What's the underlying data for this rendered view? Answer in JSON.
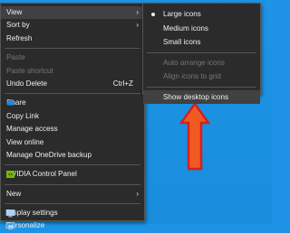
{
  "main_menu": {
    "view": "View",
    "sort_by": "Sort by",
    "refresh": "Refresh",
    "paste": "Paste",
    "paste_shortcut": "Paste shortcut",
    "undo_delete": "Undo Delete",
    "undo_delete_shortcut": "Ctrl+Z",
    "share": "Share",
    "copy_link": "Copy Link",
    "manage_access": "Manage access",
    "view_online": "View online",
    "manage_onedrive_backup": "Manage OneDrive backup",
    "nvidia_control_panel": "NVIDIA Control Panel",
    "new": "New",
    "display_settings": "Display settings",
    "personalize": "Personalize"
  },
  "view_submenu": {
    "large_icons": "Large icons",
    "medium_icons": "Medium icons",
    "small_icons": "Small icons",
    "auto_arrange_icons": "Auto arrange icons",
    "align_icons_to_grid": "Align icons to grid",
    "show_desktop_icons": "Show desktop icons"
  },
  "icons": {
    "share": "cloud-icon",
    "nvidia": "nvidia-icon",
    "display": "display-icon",
    "personalize": "personalize-icon",
    "chevron": "chevron-right-icon",
    "selected": "radio-dot-icon",
    "arrow": "up-arrow-icon"
  },
  "colors": {
    "desktop": "#1992e4",
    "menu_bg": "#2b2b2b",
    "menu_text": "#f0f0f0",
    "disabled_text": "#777777",
    "highlight": "#414141",
    "arrow_fill": "#f15a22",
    "arrow_stroke": "#d61f1f"
  }
}
